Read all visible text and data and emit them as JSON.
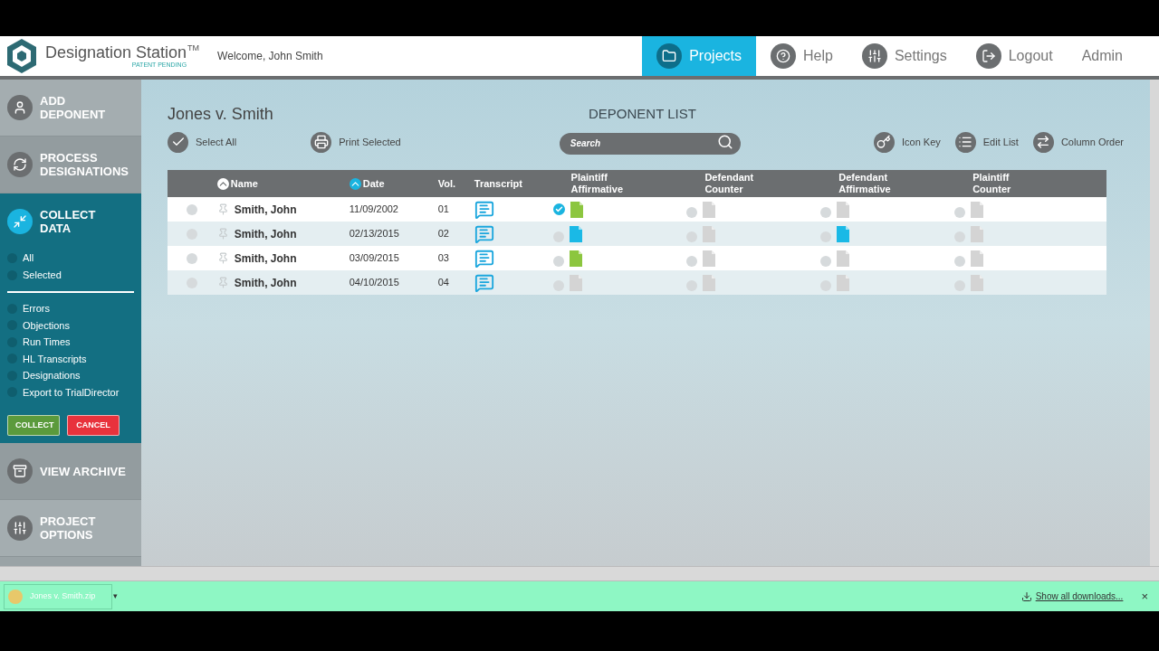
{
  "header": {
    "brand": "Designation Station",
    "trademark": "TM",
    "tagline": "PATENT PENDING",
    "welcome": "Welcome, John Smith",
    "nav": [
      {
        "label": "Projects",
        "selected": true
      },
      {
        "label": "Help",
        "selected": false
      },
      {
        "label": "Settings",
        "selected": false
      },
      {
        "label": "Logout",
        "selected": false
      },
      {
        "label": "Admin",
        "selected": false
      }
    ]
  },
  "sidebar": {
    "items": [
      {
        "label": "ADD DEPONENT",
        "expanded": false
      },
      {
        "label": "PROCESS DESIGNATIONS",
        "expanded": false
      },
      {
        "label": "COLLECT DATA",
        "expanded": true,
        "scope": [
          {
            "label": "All",
            "selected": false
          },
          {
            "label": "Selected",
            "selected": false
          }
        ],
        "options": [
          {
            "label": "Errors",
            "checked": false
          },
          {
            "label": "Objections",
            "checked": false
          },
          {
            "label": "Run Times",
            "checked": false
          },
          {
            "label": "HL Transcripts",
            "checked": false
          },
          {
            "label": "Designations",
            "checked": false
          },
          {
            "label": "Export to TrialDirector",
            "checked": false
          }
        ],
        "buttons": [
          {
            "label": "COLLECT",
            "kind": "primary"
          },
          {
            "label": "CANCEL",
            "kind": "danger"
          }
        ]
      },
      {
        "label": "VIEW ARCHIVE",
        "expanded": false
      },
      {
        "label": "PROJECT OPTIONS",
        "expanded": false
      }
    ]
  },
  "main": {
    "case_title": "Jones v. Smith",
    "list_title": "DEPONENT LIST",
    "toolbar_left": [
      {
        "label": "Select All"
      },
      {
        "label": "Print Selected"
      }
    ],
    "search": {
      "placeholder": "Search"
    },
    "toolbar_right": [
      {
        "label": "Icon Key"
      },
      {
        "label": "Edit List"
      },
      {
        "label": "Column Order"
      }
    ],
    "table": {
      "columns": [
        "Name",
        "Date",
        "Vol.",
        "Transcript"
      ],
      "designation_columns": [
        [
          "Plaintiff",
          "Affirmative"
        ],
        [
          "Defendant",
          "Counter"
        ],
        [
          "Defendant",
          "Affirmative"
        ],
        [
          "Plaintiff",
          "Counter"
        ]
      ],
      "rows": [
        {
          "selected": false,
          "name": "Smith, John",
          "date": "11/09/2002",
          "vol": "01",
          "designations": [
            {
              "checked": true,
              "color": "#8cc63f"
            },
            {
              "checked": false,
              "color": "#d4d4d4"
            },
            {
              "checked": false,
              "color": "#d4d4d4"
            },
            {
              "checked": false,
              "color": "#d4d4d4"
            }
          ]
        },
        {
          "selected": false,
          "name": "Smith, John",
          "date": "02/13/2015",
          "vol": "02",
          "designations": [
            {
              "checked": false,
              "color": "#1ab9e6"
            },
            {
              "checked": false,
              "color": "#d4d4d4"
            },
            {
              "checked": false,
              "color": "#1ab9e6"
            },
            {
              "checked": false,
              "color": "#d4d4d4"
            }
          ]
        },
        {
          "selected": false,
          "name": "Smith, John",
          "date": "03/09/2015",
          "vol": "03",
          "designations": [
            {
              "checked": false,
              "color": "#8cc63f"
            },
            {
              "checked": false,
              "color": "#d4d4d4"
            },
            {
              "checked": false,
              "color": "#d4d4d4"
            },
            {
              "checked": false,
              "color": "#d4d4d4"
            }
          ]
        },
        {
          "selected": false,
          "name": "Smith, John",
          "date": "04/10/2015",
          "vol": "04",
          "designations": [
            {
              "checked": false,
              "color": "#d4d4d4"
            },
            {
              "checked": false,
              "color": "#d4d4d4"
            },
            {
              "checked": false,
              "color": "#d4d4d4"
            },
            {
              "checked": false,
              "color": "#d4d4d4"
            }
          ]
        }
      ]
    }
  },
  "downloads": {
    "file": "Jones v. Smith.zip",
    "caret": "▾",
    "show_all": "Show all downloads...",
    "close": "×"
  }
}
